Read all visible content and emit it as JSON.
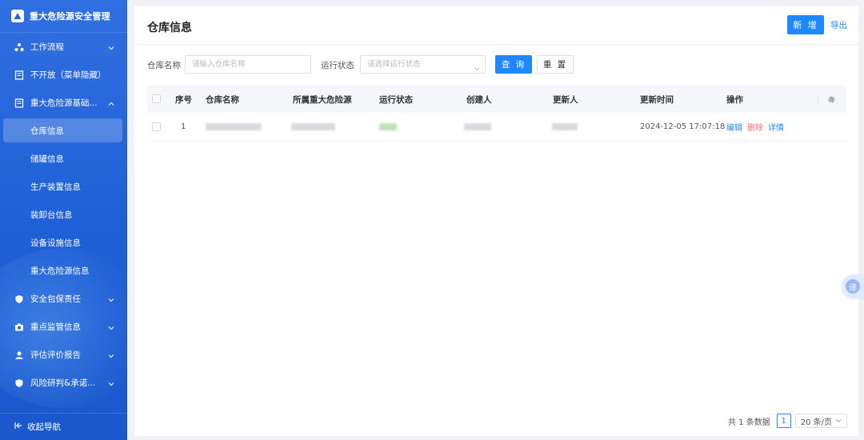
{
  "app": {
    "title": "重大危险源安全管理"
  },
  "sidebar": {
    "items": [
      {
        "label": "工作流程",
        "icon": "workflow-icon"
      },
      {
        "label": "不开放（菜单隐藏）",
        "icon": "document-icon"
      },
      {
        "label": "重大危险源基础...",
        "icon": "document-icon"
      }
    ],
    "sub_items": [
      {
        "label": "仓库信息"
      },
      {
        "label": "储罐信息"
      },
      {
        "label": "生产装置信息"
      },
      {
        "label": "装卸台信息"
      },
      {
        "label": "设备设施信息"
      },
      {
        "label": "重大危险源信息"
      }
    ],
    "items_bottom": [
      {
        "label": "安全包保责任",
        "icon": "shield-icon"
      },
      {
        "label": "重点监管信息",
        "icon": "camera-icon"
      },
      {
        "label": "评估评价报告",
        "icon": "user-icon"
      },
      {
        "label": "风险研判&承诺...",
        "icon": "shield-icon"
      }
    ],
    "collapse_label": "收起导航"
  },
  "main": {
    "title": "仓库信息",
    "add_label": "新 增",
    "export_label": "导出",
    "filters": {
      "name_label": "仓库名称",
      "name_placeholder": "请输入仓库名称",
      "status_label": "运行状态",
      "status_placeholder": "请选择运行状态",
      "query_label": "查 询",
      "reset_label": "重 置"
    },
    "table": {
      "headers": [
        "序号",
        "仓库名称",
        "所属重大危险源",
        "运行状态",
        "创建人",
        "更新人",
        "更新时间",
        "操作"
      ],
      "rows": [
        {
          "index": "1",
          "updated_at": "2024-12-05 17:07:18",
          "actions": [
            "编辑",
            "删除",
            "详情"
          ]
        }
      ]
    },
    "pagination": {
      "total_text": "共 1 条数据",
      "current_page": "1",
      "page_size": "20 条/页"
    }
  },
  "float": {
    "translate_label": "译"
  },
  "colors": {
    "primary": "#1e88ff",
    "sidebar": "#2463da",
    "danger": "#ff6b6b"
  }
}
